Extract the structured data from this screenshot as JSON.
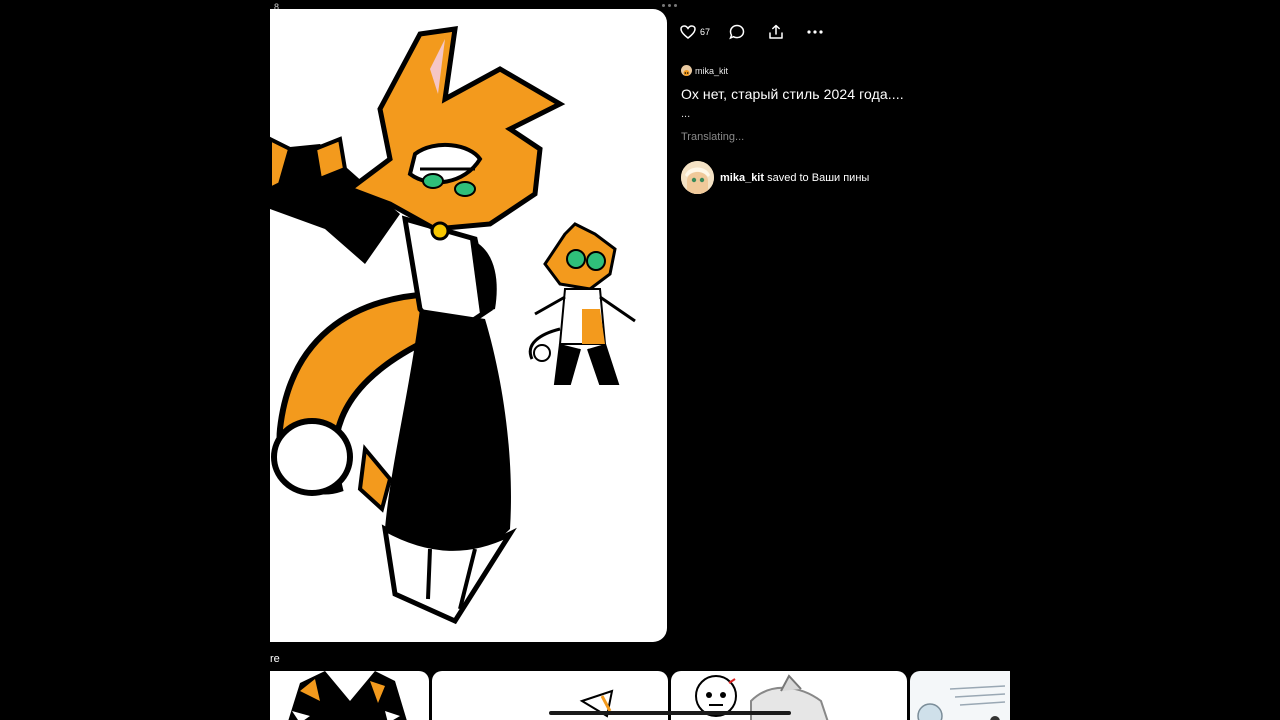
{
  "status": {
    "time": "8"
  },
  "pin": {
    "image_alt": "Orange and black cat character drawing by mika_kit"
  },
  "actions": {
    "like_count": "67"
  },
  "author": {
    "name": "mika_kit"
  },
  "title": "Ох нет, старый стиль 2024 года....",
  "description": "...",
  "translating": "Translating...",
  "saved": {
    "user": "mika_kit",
    "text": "saved to Ваши пины"
  },
  "more_section": {
    "label": "re"
  },
  "icons": {
    "like": "heart-icon",
    "comment": "comment-icon",
    "share": "share-icon",
    "more": "more-dots-icon",
    "visual_search": "visual-search-icon"
  },
  "colors": {
    "background": "#000000",
    "accent_orange": "#f39a1d",
    "muted_text": "#8a8a8a"
  }
}
